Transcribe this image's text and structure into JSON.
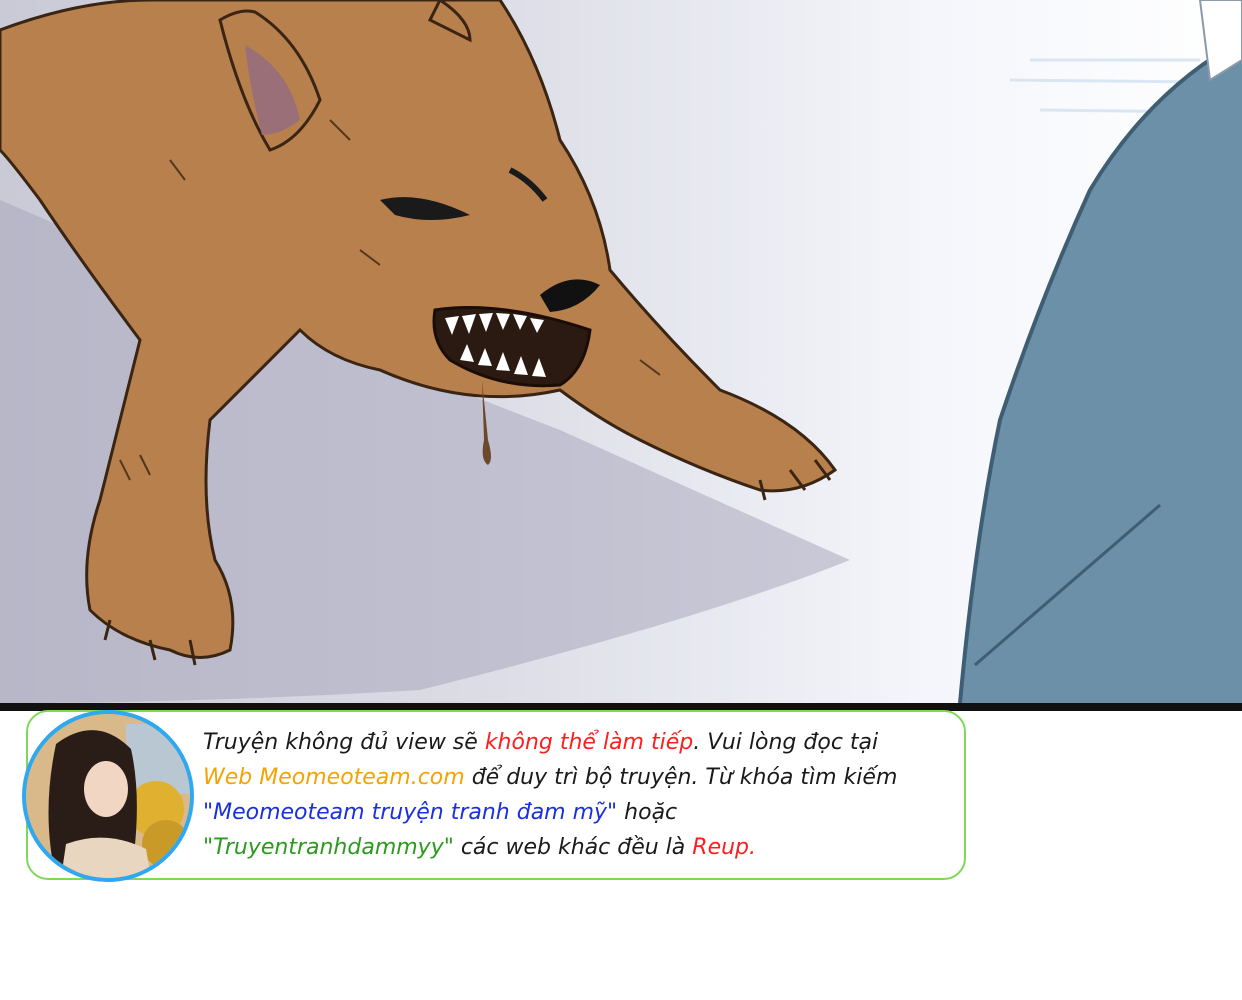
{
  "notice": {
    "line1": {
      "part1": "Truyện không đủ view sẽ ",
      "part2": "không thể làm tiếp",
      "part3": ". Vui lòng đọc tại"
    },
    "line2": {
      "part1": "Web Meomeoteam.com",
      "part2": " để duy trì bộ truyện. Từ khóa tìm kiếm"
    },
    "line3": {
      "part1": "\"Meomeoteam truyện tranh đam mỹ\"",
      "part2": " hoặc"
    },
    "line4": {
      "part1": "\"Truyentranhdammyy\"",
      "part2": " các web khác đều là ",
      "part3": "Reup."
    }
  },
  "colors": {
    "warning": "#ff1e1e",
    "site": "#f5a300",
    "keyword1": "#1a2fe0",
    "keyword2": "#2c9a1e",
    "border": "#7ed957",
    "avatar_ring": "#2ea8f0"
  }
}
